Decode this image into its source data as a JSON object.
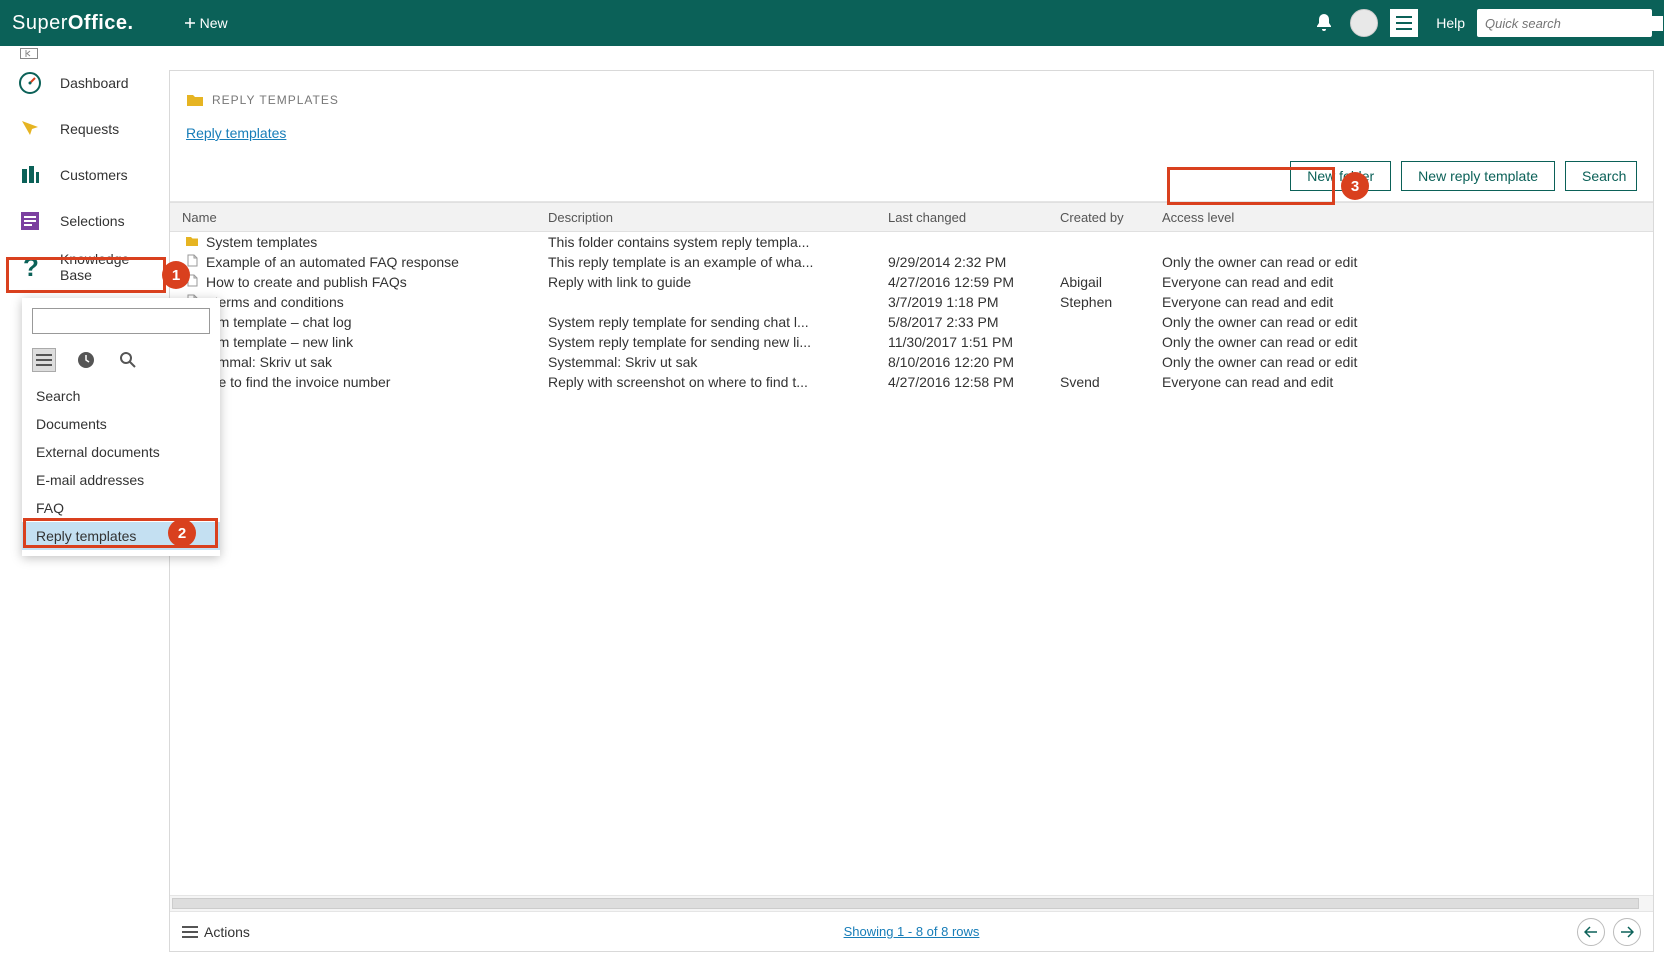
{
  "header": {
    "logo_part1": "Super",
    "logo_part2": "Office.",
    "new_label": "New",
    "help_label": "Help",
    "search_placeholder": "Quick search"
  },
  "sidebar": {
    "items": [
      {
        "label": "Dashboard"
      },
      {
        "label": "Requests"
      },
      {
        "label": "Customers"
      },
      {
        "label": "Selections"
      },
      {
        "label": "Knowledge Base"
      }
    ]
  },
  "dropdown": {
    "items": [
      {
        "label": "Search"
      },
      {
        "label": "Documents"
      },
      {
        "label": "External documents"
      },
      {
        "label": "E-mail addresses"
      },
      {
        "label": "FAQ"
      },
      {
        "label": "Reply templates"
      }
    ]
  },
  "main": {
    "title": "REPLY TEMPLATES",
    "breadcrumb": "Reply templates",
    "buttons": {
      "new_folder": "New folder",
      "new_reply_template": "New reply template",
      "search": "Search"
    },
    "columns": {
      "name": "Name",
      "description": "Description",
      "last_changed": "Last changed",
      "created_by": "Created by",
      "access": "Access level"
    },
    "rows": [
      {
        "type": "folder",
        "name": "System templates",
        "description": "This folder contains system reply templa...",
        "last": "",
        "created": "",
        "access": ""
      },
      {
        "type": "doc",
        "name": "Example of an automated FAQ response",
        "description": "This reply template is an example of wha...",
        "last": "9/29/2014 2:32 PM",
        "created": "",
        "access": "Only the owner can read or edit"
      },
      {
        "type": "doc",
        "name": "How to create and publish FAQs",
        "description": "Reply with link to guide",
        "last": "4/27/2016 12:59 PM",
        "created": "Abigail",
        "access": "Everyone can read and edit"
      },
      {
        "type": "doc",
        "name": "r terms and conditions",
        "description": "",
        "last": "3/7/2019 1:18 PM",
        "created": "Stephen",
        "access": "Everyone can read and edit"
      },
      {
        "type": "doc",
        "name": "tem template – chat log",
        "description": "System reply template for sending chat l...",
        "last": "5/8/2017 2:33 PM",
        "created": "",
        "access": "Only the owner can read or edit"
      },
      {
        "type": "doc",
        "name": "tem template – new link",
        "description": "System reply template for sending new li...",
        "last": "11/30/2017 1:51 PM",
        "created": "",
        "access": "Only the owner can read or edit"
      },
      {
        "type": "doc",
        "name": "temmal: Skriv ut sak",
        "description": "Systemmal: Skriv ut sak",
        "last": "8/10/2016 12:20 PM",
        "created": "",
        "access": "Only the owner can read or edit"
      },
      {
        "type": "doc",
        "name": "ere to find the invoice number",
        "description": "Reply with screenshot on where to find t...",
        "last": "4/27/2016 12:58 PM",
        "created": "Svend",
        "access": "Everyone can read and edit"
      }
    ]
  },
  "footer": {
    "actions": "Actions",
    "showing": "Showing 1 - 8 of 8 rows"
  },
  "callouts": {
    "c1": "1",
    "c2": "2",
    "c3": "3"
  }
}
